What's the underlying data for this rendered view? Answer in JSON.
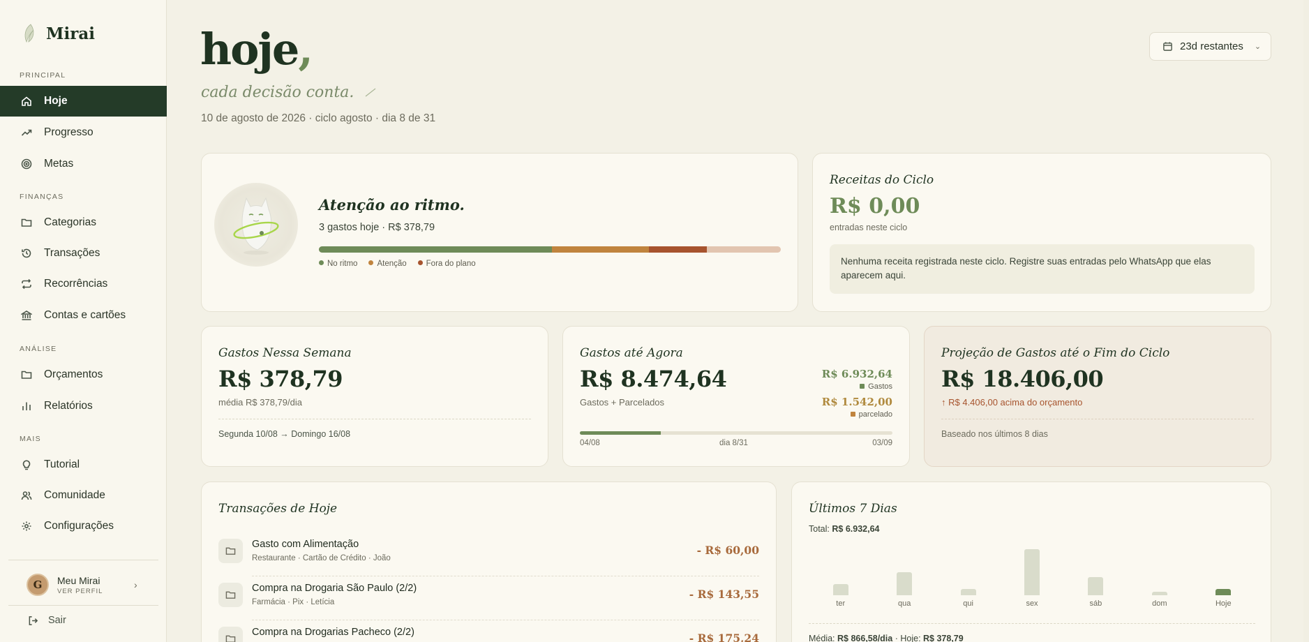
{
  "brand": {
    "name": "Mirai"
  },
  "sidebar": {
    "sections": [
      {
        "label": "PRINCIPAL",
        "items": [
          "Hoje",
          "Progresso",
          "Metas"
        ]
      },
      {
        "label": "FINANÇAS",
        "items": [
          "Categorias",
          "Transações",
          "Recorrências",
          "Contas e cartões"
        ]
      },
      {
        "label": "ANÁLISE",
        "items": [
          "Orçamentos",
          "Relatórios"
        ]
      },
      {
        "label": "MAIS",
        "items": [
          "Tutorial",
          "Comunidade",
          "Configurações"
        ]
      }
    ],
    "active_item": "Hoje",
    "profile": {
      "initial": "G",
      "name": "Meu Mirai",
      "sub": "VER PERFIL"
    },
    "logout": "Sair"
  },
  "header": {
    "title": "hoje",
    "title_comma": ",",
    "subtitle": "cada decisão conta.",
    "dateline": "10 de agosto de 2026 · ciclo agosto · dia 8 de 31",
    "cycle_button": "23d restantes"
  },
  "status": {
    "title": "Atenção ao ritmo.",
    "subtitle": "3 gastos hoje · R$ 378,79",
    "bar_fractions": {
      "no_ritmo": 0.505,
      "atencao": 0.21,
      "fora_do_plano": 0.125
    },
    "legend": [
      {
        "label": "No ritmo",
        "color": "#6e8b58"
      },
      {
        "label": "Atenção",
        "color": "#c0843e"
      },
      {
        "label": "Fora do plano",
        "color": "#a7542e"
      }
    ]
  },
  "income": {
    "title": "Receitas do Ciclo",
    "value": "R$ 0,00",
    "note": "entradas neste ciclo",
    "message": "Nenhuma receita registrada neste ciclo. Registre suas entradas pelo WhatsApp que elas aparecem aqui."
  },
  "week": {
    "title": "Gastos Nessa Semana",
    "value": "R$ 378,79",
    "average": "média R$ 378,79/dia",
    "range": "Segunda 10/08 → Domingo 16/08"
  },
  "so_far": {
    "title": "Gastos até Agora",
    "value": "R$ 8.474,64",
    "note": "Gastos + Parcelados",
    "gastos_value": "R$ 6.932,64",
    "gastos_label": "Gastos",
    "parcelado_value": "R$ 1.542,00",
    "parcelado_label": "parcelado",
    "progress_fraction": 0.258,
    "start": "04/08",
    "day": "dia 8/31",
    "end": "03/09"
  },
  "projection": {
    "title": "Projeção de Gastos até o Fim do Ciclo",
    "value": "R$ 18.406,00",
    "delta": "↑ R$ 4.406,00 acima do orçamento",
    "note": "Baseado nos últimos 8 dias"
  },
  "transactions": {
    "title": "Transações de Hoje",
    "rows": [
      {
        "name": "Gasto com Alimentação",
        "meta": "Restaurante · Cartão de Crédito · João",
        "amount": "- R$ 60,00"
      },
      {
        "name": "Compra na Drogaria São Paulo (2/2)",
        "meta": "Farmácia · Pix · Letícia",
        "amount": "- R$ 143,55"
      },
      {
        "name": "Compra na Drogarias Pacheco (2/2)",
        "meta": "",
        "amount": "- R$ 175,24"
      }
    ]
  },
  "last7": {
    "title": "Últimos 7 Dias",
    "total_label": "Total:",
    "total_value": "R$ 6.932,64",
    "footer_avg_label": "Média:",
    "footer_avg_value": "R$ 866,58/dia",
    "footer_today_label": "Hoje:",
    "footer_today_value": "R$ 378,79"
  },
  "chart_data": {
    "type": "bar",
    "categories": [
      "ter",
      "qua",
      "qui",
      "sex",
      "sáb",
      "dom",
      "Hoje"
    ],
    "values": [
      0.24,
      0.5,
      0.13,
      1.0,
      0.4,
      0.08,
      0.14
    ],
    "highlight": "Hoje",
    "colors": {
      "default": "#d9dccb",
      "highlight": "#6e8b58"
    }
  }
}
